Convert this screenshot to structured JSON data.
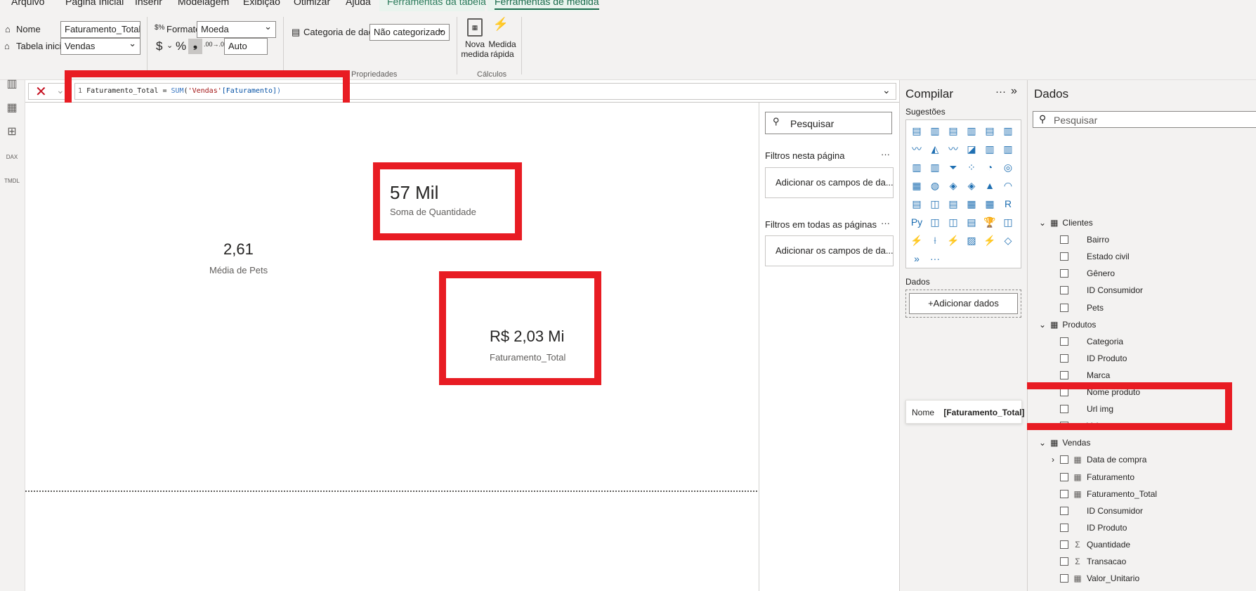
{
  "ribbon": {
    "tabs": [
      "Arquivo",
      "Página Inicial",
      "Inserir",
      "Modelagem",
      "Exibição",
      "Otimizar",
      "Ajuda"
    ],
    "context_tabs": [
      "Ferramentas da tabela",
      "Ferramentas de medida"
    ],
    "active_tab": "Ferramentas de medida",
    "nome_label": "Nome",
    "nome_value": "Faturamento_Total",
    "tabela_label": "Tabela inicial",
    "tabela_value": "Vendas",
    "formato_label": "Formato",
    "formato_value": "Moeda",
    "currency_symbol": "$",
    "percent_symbol": "%",
    "comma_symbol": "❟",
    "decimals_symbol": ".00→.0",
    "auto_value": "Auto",
    "categoria_label": "Categoria de dados",
    "categoria_value": "Não categorizado",
    "propriedades_group": "Propriedades",
    "nova_medida": "Nova medida",
    "medida_rapida": "Medida rápida",
    "calculos_group": "Cálculos"
  },
  "leftnav": {
    "icons": [
      "report-view-icon",
      "table-view-icon",
      "model-view-icon",
      "dax-query-icon",
      "tmdl-view-icon"
    ],
    "dax_text": "DAX",
    "tmdl_text": "TMDL"
  },
  "formula": {
    "line_number": "1",
    "measure_name": "Faturamento_Total",
    "equals": " = ",
    "func": "SUM",
    "open": "(",
    "table_ref": "'Vendas'",
    "column_ref": "[Faturamento]",
    "close": ")"
  },
  "canvas": {
    "card1": {
      "value": "57 Mil",
      "label": "Soma de Quantidade"
    },
    "card2": {
      "value": "2,61",
      "label": "Média de Pets"
    },
    "card3": {
      "value": "R$ 2,03 Mi",
      "label": "Faturamento_Total"
    }
  },
  "filters": {
    "search_placeholder": "Pesquisar",
    "page_filters_title": "Filtros nesta página",
    "page_filters_box": "Adicionar os campos de da...",
    "all_pages_title": "Filtros em todas as páginas",
    "all_pages_box": "Adicionar os campos de da...",
    "more": "···"
  },
  "compilar": {
    "title": "Compilar",
    "more": "···",
    "collapse": "»",
    "suggestions_label": "Sugestões",
    "dados_label": "Dados",
    "add_data_button": "+Adicionar dados",
    "tooltip_key": "Nome",
    "tooltip_value": "[Faturamento_Total]",
    "visual_glyphs": [
      "▤",
      "▥",
      "▤",
      "▥",
      "▤",
      "▥",
      "〰",
      "◭",
      "〰",
      "◪",
      "▥",
      "▥",
      "▥",
      "▥",
      "⏷",
      "⁘",
      "◔",
      "◎",
      "▦",
      "◍",
      "◈",
      "◈",
      "▲",
      "◠",
      "▤",
      "◫",
      "▤",
      "▦",
      "▦",
      "R",
      "Py",
      "◫",
      "◫",
      "▤",
      "🏆",
      "◫",
      "⚡",
      "⟊",
      "⚡",
      "▨",
      "⚡",
      "◇",
      "»",
      "···"
    ]
  },
  "dados": {
    "title": "Dados",
    "search_placeholder": "Pesquisar",
    "tables": [
      {
        "name": "Clientes",
        "fields": [
          {
            "name": "Bairro",
            "icon": ""
          },
          {
            "name": "Estado civil",
            "icon": ""
          },
          {
            "name": "Gênero",
            "icon": ""
          },
          {
            "name": "ID Consumidor",
            "icon": ""
          },
          {
            "name": "Pets",
            "icon": ""
          }
        ]
      },
      {
        "name": "Produtos",
        "fields": [
          {
            "name": "Categoria",
            "icon": ""
          },
          {
            "name": "ID Produto",
            "icon": ""
          },
          {
            "name": "Marca",
            "icon": ""
          },
          {
            "name": "Nome produto",
            "icon": ""
          },
          {
            "name": "Url img",
            "icon": ""
          },
          {
            "name": "Valor",
            "icon": ""
          }
        ]
      },
      {
        "name": "Vendas",
        "fields": [
          {
            "name": "Data de compra",
            "icon": "▦"
          },
          {
            "name": "Faturamento",
            "icon": "▦"
          },
          {
            "name": "Faturamento_Total",
            "icon": "▦"
          },
          {
            "name": "ID Consumidor",
            "icon": ""
          },
          {
            "name": "ID Produto",
            "icon": ""
          },
          {
            "name": "Quantidade",
            "icon": "Σ"
          },
          {
            "name": "Transacao",
            "icon": "Σ"
          },
          {
            "name": "Valor_Unitario",
            "icon": "▦"
          }
        ]
      }
    ]
  },
  "colors": {
    "highlight_red": "#e81c23",
    "context_green": "#1b6b4c",
    "pane_bg": "#f3f2f1"
  }
}
